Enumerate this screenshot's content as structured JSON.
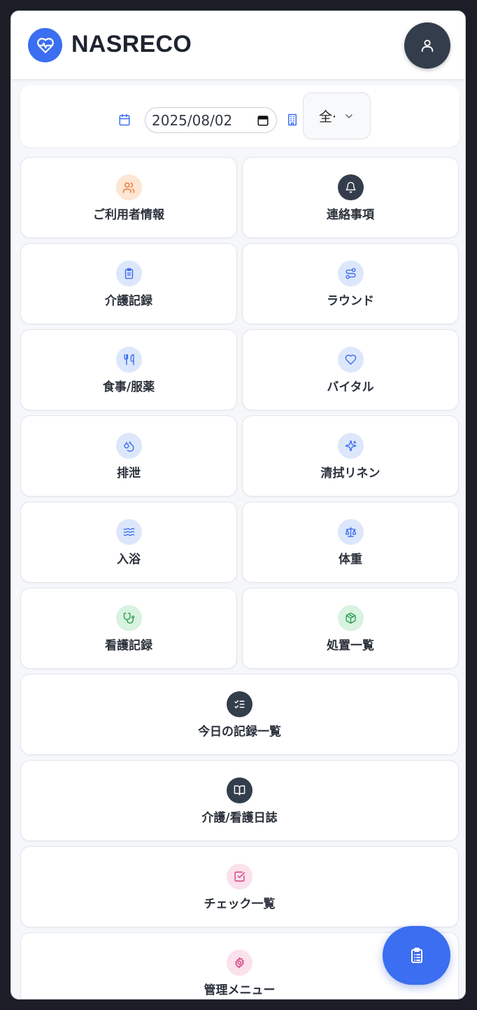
{
  "app": {
    "title": "NASRECO"
  },
  "colors": {
    "accent": "#3b6ef0",
    "dark": "#343d4b",
    "text": "#2b313b"
  },
  "header": {
    "logo_icon": "heart-pulse-icon",
    "avatar_icon": "user-icon"
  },
  "filters": {
    "date_value": "2025/08/02",
    "facility_value": "全·"
  },
  "menu": {
    "items": [
      {
        "label": "ご利用者情報",
        "icon": "users-icon"
      },
      {
        "label": "連絡事項",
        "icon": "bell-icon"
      },
      {
        "label": "介護記録",
        "icon": "clipboard-icon"
      },
      {
        "label": "ラウンド",
        "icon": "route-icon"
      },
      {
        "label": "食事/服薬",
        "icon": "utensils-icon"
      },
      {
        "label": "バイタル",
        "icon": "heart-icon"
      },
      {
        "label": "排泄",
        "icon": "droplets-icon"
      },
      {
        "label": "清拭リネン",
        "icon": "sparkles-icon"
      },
      {
        "label": "入浴",
        "icon": "waves-icon"
      },
      {
        "label": "体重",
        "icon": "scale-icon"
      },
      {
        "label": "看護記録",
        "icon": "stethoscope-icon"
      },
      {
        "label": "処置一覧",
        "icon": "package-icon"
      },
      {
        "label": "今日の記録一覧",
        "icon": "list-checks-icon"
      },
      {
        "label": "介護/看護日誌",
        "icon": "book-open-icon"
      },
      {
        "label": "チェック一覧",
        "icon": "square-check-icon"
      },
      {
        "label": "管理メニュー",
        "icon": "gear-icon"
      }
    ]
  },
  "fab": {
    "icon": "clipboard-list-icon"
  }
}
